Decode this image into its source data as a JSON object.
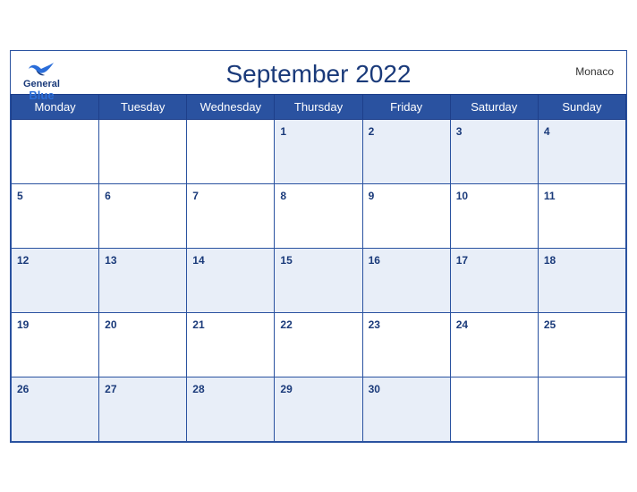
{
  "header": {
    "title": "September 2022",
    "country": "Monaco",
    "logo": {
      "general": "General",
      "blue": "Blue"
    }
  },
  "weekdays": [
    "Monday",
    "Tuesday",
    "Wednesday",
    "Thursday",
    "Friday",
    "Saturday",
    "Sunday"
  ],
  "weeks": [
    [
      null,
      null,
      null,
      1,
      2,
      3,
      4
    ],
    [
      5,
      6,
      7,
      8,
      9,
      10,
      11
    ],
    [
      12,
      13,
      14,
      15,
      16,
      17,
      18
    ],
    [
      19,
      20,
      21,
      22,
      23,
      24,
      25
    ],
    [
      26,
      27,
      28,
      29,
      30,
      null,
      null
    ]
  ]
}
